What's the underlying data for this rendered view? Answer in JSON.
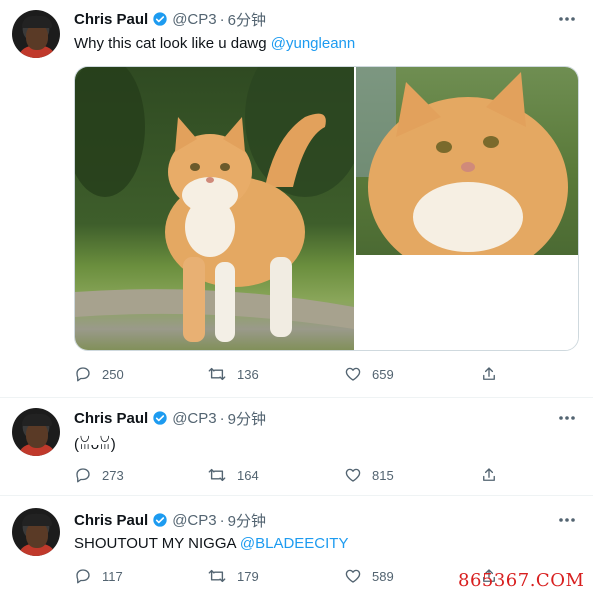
{
  "colors": {
    "accent": "#1d9bf0",
    "muted": "#536471",
    "text": "#0f1419",
    "watermark": "#d81f1f"
  },
  "tweets": [
    {
      "name": "Chris Paul",
      "handle": "@CP3",
      "separator": "·",
      "time": "6分钟",
      "text": "Why this cat look like u dawg ",
      "mention": "@yungleann",
      "has_media": true,
      "media": [
        "orange cat standing on grass",
        "orange cat close-up"
      ],
      "reply_count": "250",
      "retweet_count": "136",
      "like_count": "659"
    },
    {
      "name": "Chris Paul",
      "handle": "@CP3",
      "separator": "·",
      "time": "9分钟",
      "text": "(ꈍᴗꈍ)",
      "mention": "",
      "reply_count": "273",
      "retweet_count": "164",
      "like_count": "815"
    },
    {
      "name": "Chris Paul",
      "handle": "@CP3",
      "separator": "·",
      "time": "9分钟",
      "text": "SHOUTOUT MY NIGGA ",
      "mention": "@BLADEECITY",
      "reply_count": "117",
      "retweet_count": "179",
      "like_count": "589"
    }
  ],
  "icons": [
    "verified-icon",
    "more-icon",
    "reply-icon",
    "retweet-icon",
    "like-icon",
    "share-icon"
  ],
  "watermark": "865367.COM"
}
